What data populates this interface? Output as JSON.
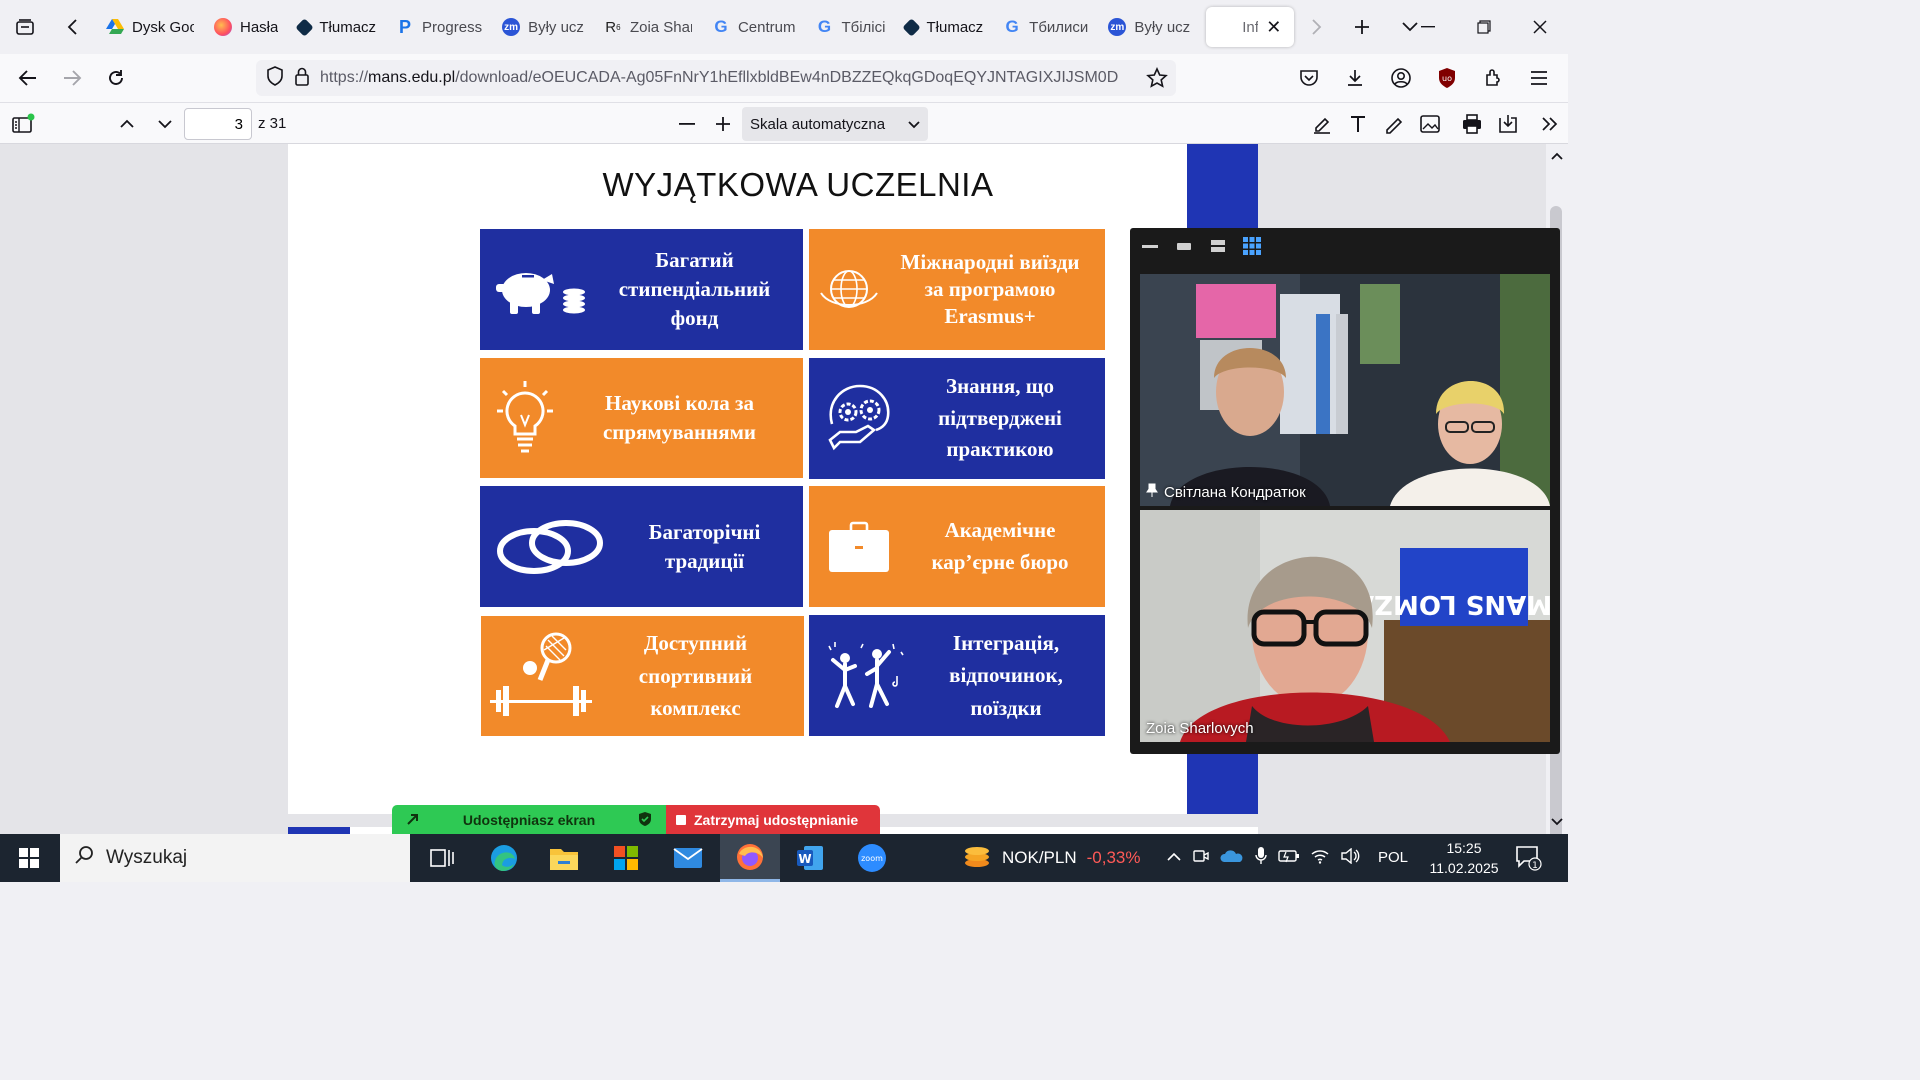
{
  "tabs": [
    {
      "label": "Dysk Google",
      "favicon": "google-drive-icon",
      "color": "#34a853"
    },
    {
      "label": "Hasła",
      "favicon": "firefox-icon",
      "color": "#ff7139"
    },
    {
      "label": "Tłumacz",
      "favicon": "deepl-icon",
      "color": "#0f2b46"
    },
    {
      "label": "Progress",
      "favicon": "p-icon",
      "color": "#1a73e8"
    },
    {
      "label": "Były ucz",
      "favicon": "zm-icon",
      "color": "#2b55d6"
    },
    {
      "label": "Zoia Sharlovych",
      "favicon": "researchgate-icon",
      "color": "#222222"
    },
    {
      "label": "Centrum",
      "favicon": "google-icon",
      "color": "#4285f4"
    },
    {
      "label": "Тбілісі",
      "favicon": "google-icon",
      "color": "#4285f4"
    },
    {
      "label": "Tłumacz",
      "favicon": "deepl-icon",
      "color": "#0f2b46"
    },
    {
      "label": "Тбилиси",
      "favicon": "google-icon",
      "color": "#4285f4"
    },
    {
      "label": "Były ucz",
      "favicon": "zm-icon",
      "color": "#2b55d6"
    }
  ],
  "active_tab": {
    "label": "Info"
  },
  "url": "https://mans.edu.pl/download/eOEUCADA-Ag05FnNrY1hEfllxbldBEw4nDBZZEQkqGDoqEQYJNTAGIXJIJSM0D",
  "url_host": "mans.edu.pl",
  "pdf": {
    "current_page": "3",
    "total_pages": "z 31",
    "zoom": "Skala automatyczna"
  },
  "slide": {
    "title": "WYJĄTKOWA UCZELNIA",
    "cards": [
      {
        "text": "Багатий стипендіальний фонд",
        "icon": "piggy-bank-icon",
        "color": "blue"
      },
      {
        "text": "Міжнародні виїзди за програмою Erasmus+",
        "icon": "globe-icon",
        "color": "orange"
      },
      {
        "text": "Наукові кола за спрямуваннями",
        "icon": "lightbulb-icon",
        "color": "orange"
      },
      {
        "text": "Знання, що підтверджені практикою",
        "icon": "gears-hand-icon",
        "color": "blue"
      },
      {
        "text": "Багаторічні традиції",
        "icon": "rings-icon",
        "color": "blue"
      },
      {
        "text": "Академічне кар’єрне бюро",
        "icon": "briefcase-icon",
        "color": "orange"
      },
      {
        "text": "Доступний спортивний комплекс",
        "icon": "sports-icon",
        "color": "orange"
      },
      {
        "text": "Інтеграція, відпочинок, поїздки",
        "icon": "dancing-people-icon",
        "color": "blue"
      }
    ]
  },
  "zoom_panel": {
    "participants": [
      {
        "name": "Світлана Кондратюк",
        "pinned": true
      },
      {
        "name": "Zoia Sharlovych",
        "pinned": false
      }
    ],
    "banner_text": "#MANS LOMZA"
  },
  "share_bar": {
    "sharing": "Udostępniasz ekran",
    "stop": "Zatrzymaj udostępnianie"
  },
  "taskbar": {
    "search_placeholder": "Wyszukaj",
    "ticker_pair": "NOK/PLN",
    "ticker_change": "-0,33%",
    "language": "POL",
    "time": "15:25",
    "date": "11.02.2025",
    "notifications": "1"
  },
  "colors": {
    "blue": "#1f2fa0",
    "orange": "#f28a2a",
    "share_green": "#2ec954",
    "share_red": "#e0353a",
    "ticker_negative": "#ff5a57"
  }
}
